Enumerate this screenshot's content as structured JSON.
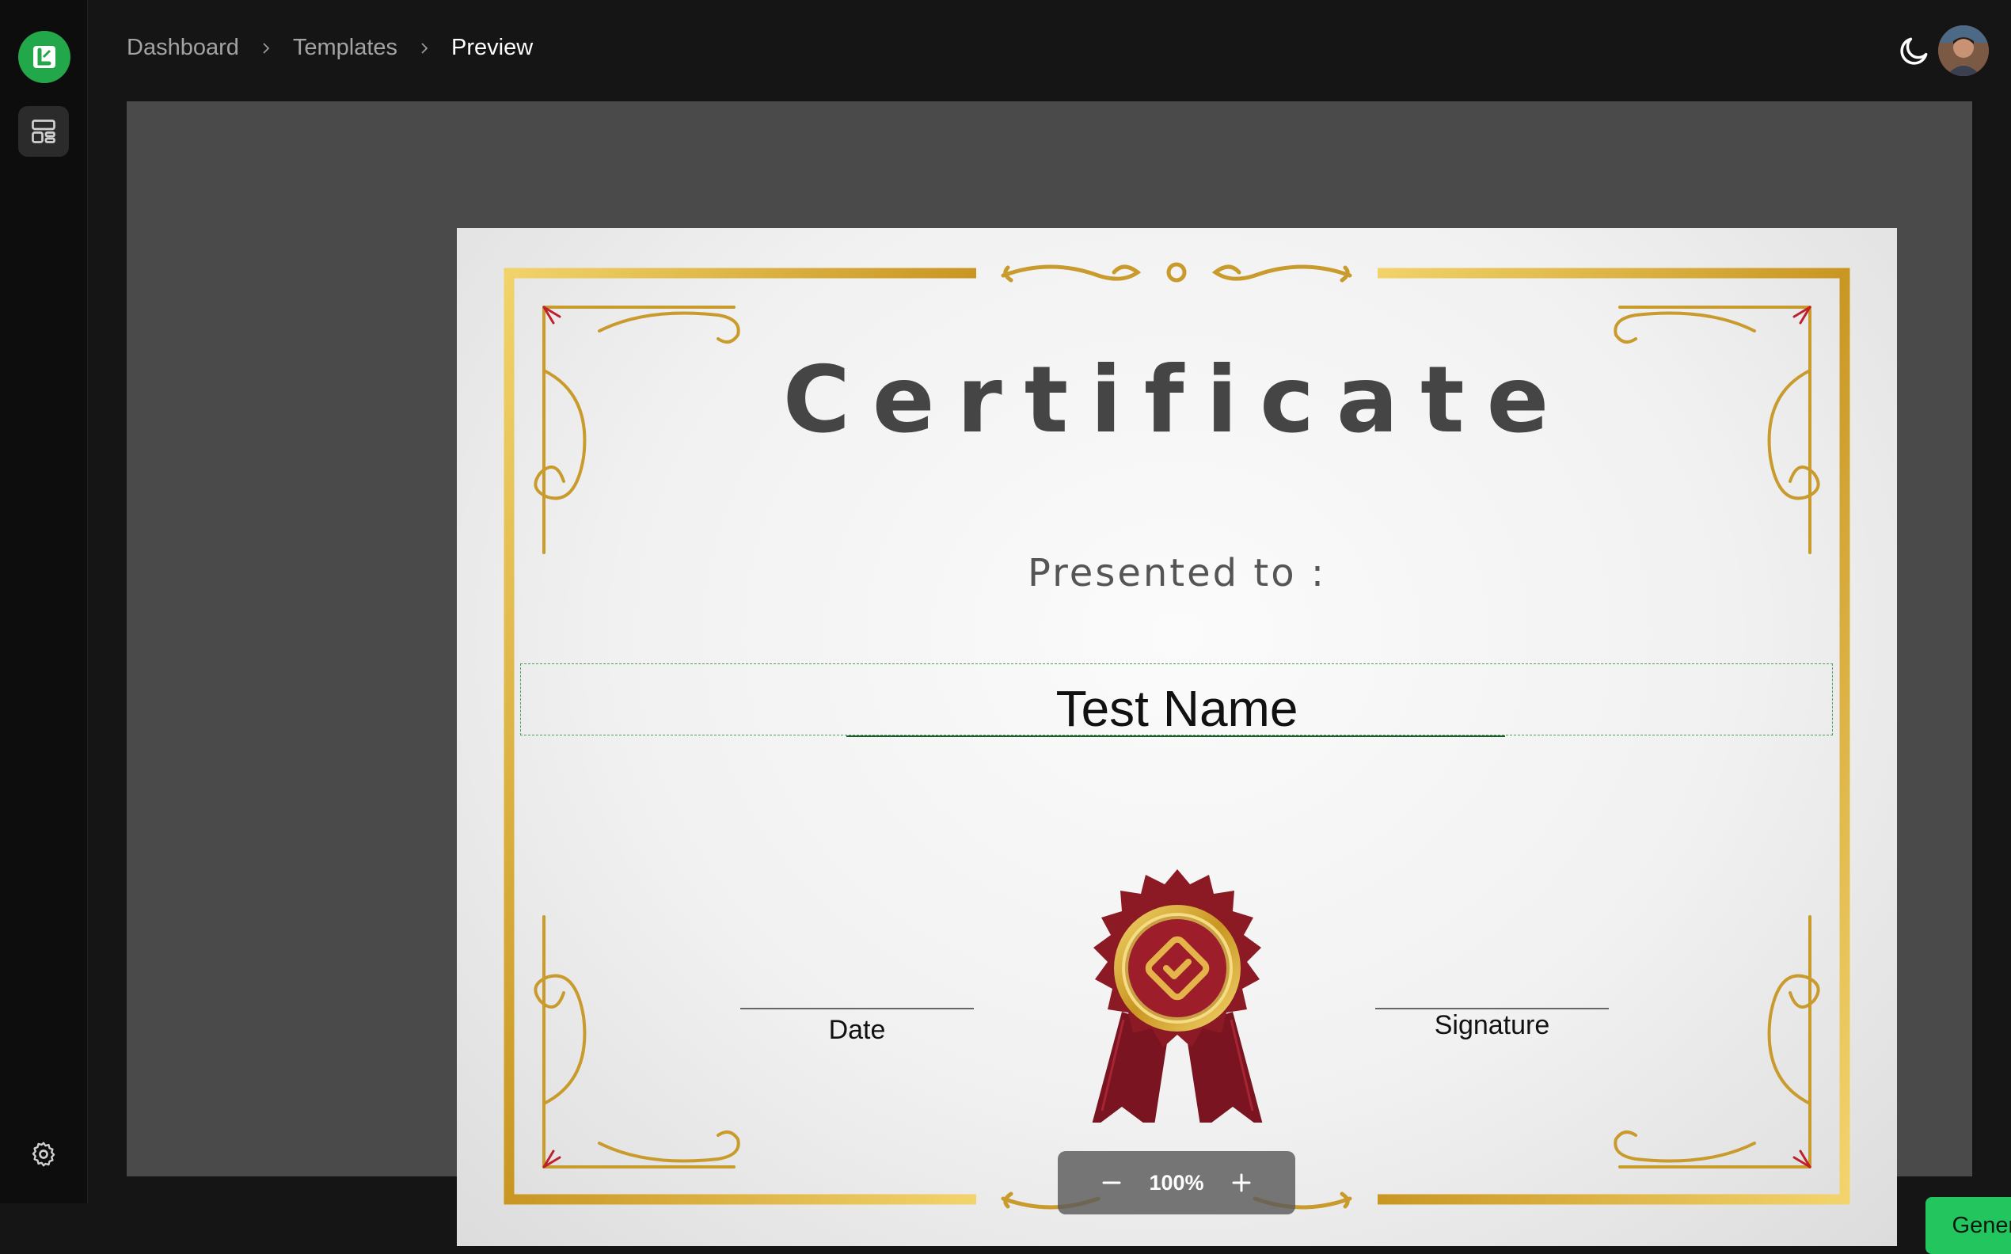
{
  "sidebar": {
    "logo_letter": "L",
    "nav_items": [
      {
        "icon": "layout-icon"
      }
    ],
    "settings_icon": "gear-icon"
  },
  "breadcrumb": {
    "items": [
      "Dashboard",
      "Templates",
      "Preview"
    ]
  },
  "topbar": {
    "theme_icon": "moon-icon",
    "avatar_icon": "user-avatar"
  },
  "certificate": {
    "title": "Certificate",
    "presented_label": "Presented to :",
    "recipient_name": "Test Name",
    "date_label": "Date",
    "signature_label": "Signature"
  },
  "zoom": {
    "value": "100%",
    "decrease_icon": "minus-icon",
    "increase_icon": "plus-icon"
  },
  "actions": {
    "generate_label": "Generate"
  },
  "colors": {
    "accent": "#22c55e",
    "gold": "#d4a22a",
    "seal_red": "#8b1a24"
  }
}
